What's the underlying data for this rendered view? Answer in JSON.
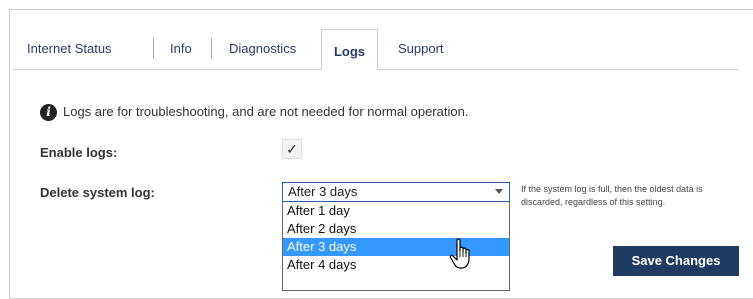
{
  "tabs": {
    "internet_status": "Internet Status",
    "info": "Info",
    "diagnostics": "Diagnostics",
    "logs": "Logs",
    "support": "Support",
    "active": "Logs"
  },
  "info_icon_glyph": "i",
  "info_text": "Logs are for troubleshooting, and are not needed for normal operation.",
  "enable_logs": {
    "label": "Enable logs:",
    "checked": true,
    "check_glyph": "✓"
  },
  "delete_log": {
    "label": "Delete system log:",
    "selected": "After 3 days",
    "options": [
      "After 1 day",
      "After 2 days",
      "After 3 days",
      "After 4 days"
    ],
    "note": "If the system log is full, then the oldest data is discarded, regardless of this setting."
  },
  "save_button": "Save Changes",
  "colors": {
    "tab_text": "#2a3a6a",
    "option_highlight": "#3399ff",
    "button_bg": "#1f3b63"
  }
}
